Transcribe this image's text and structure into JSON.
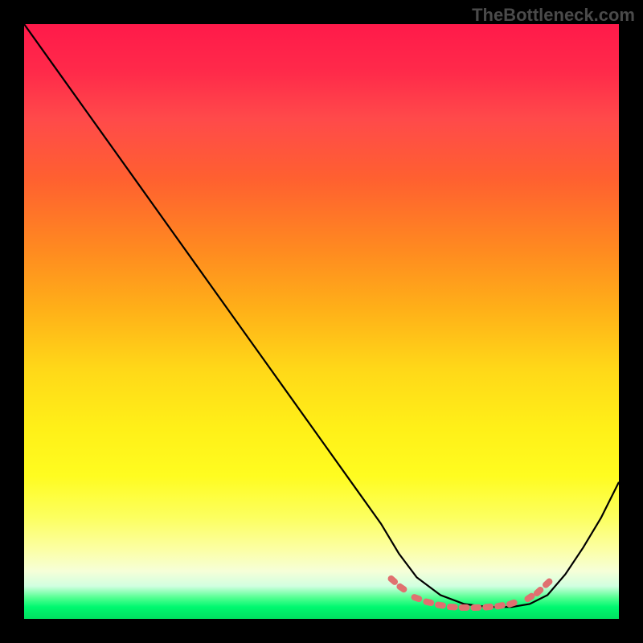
{
  "watermark": "TheBottleneck.com",
  "chart_data": {
    "type": "line",
    "title": "",
    "xlabel": "",
    "ylabel": "",
    "xlim": [
      0,
      100
    ],
    "ylim": [
      0,
      100
    ],
    "series": [
      {
        "name": "bottleneck-curve",
        "x": [
          0,
          5,
          10,
          15,
          20,
          25,
          30,
          35,
          40,
          45,
          50,
          55,
          60,
          63,
          66,
          70,
          74,
          78,
          82,
          85,
          88,
          91,
          94,
          97,
          100
        ],
        "y": [
          100,
          93,
          86,
          79,
          72,
          65,
          58,
          51,
          44,
          37,
          30,
          23,
          16,
          11,
          7,
          4,
          2.5,
          2,
          2,
          2.5,
          4,
          7.5,
          12,
          17,
          23
        ]
      }
    ],
    "markers": {
      "name": "highlight-dots",
      "color": "#e07070",
      "points": [
        {
          "x": 62,
          "y": 6.5
        },
        {
          "x": 63.5,
          "y": 5.2
        },
        {
          "x": 66,
          "y": 3.5
        },
        {
          "x": 68,
          "y": 2.8
        },
        {
          "x": 70,
          "y": 2.3
        },
        {
          "x": 72,
          "y": 2.0
        },
        {
          "x": 74,
          "y": 1.9
        },
        {
          "x": 76,
          "y": 1.9
        },
        {
          "x": 78,
          "y": 2.0
        },
        {
          "x": 80,
          "y": 2.2
        },
        {
          "x": 82,
          "y": 2.6
        },
        {
          "x": 85,
          "y": 3.6
        },
        {
          "x": 86.5,
          "y": 4.6
        },
        {
          "x": 88,
          "y": 6.0
        }
      ]
    },
    "gradient_stops": [
      {
        "pos": 0,
        "color": "#ff1a4a"
      },
      {
        "pos": 50,
        "color": "#ffd818"
      },
      {
        "pos": 85,
        "color": "#fcffa0"
      },
      {
        "pos": 100,
        "color": "#00e060"
      }
    ]
  }
}
